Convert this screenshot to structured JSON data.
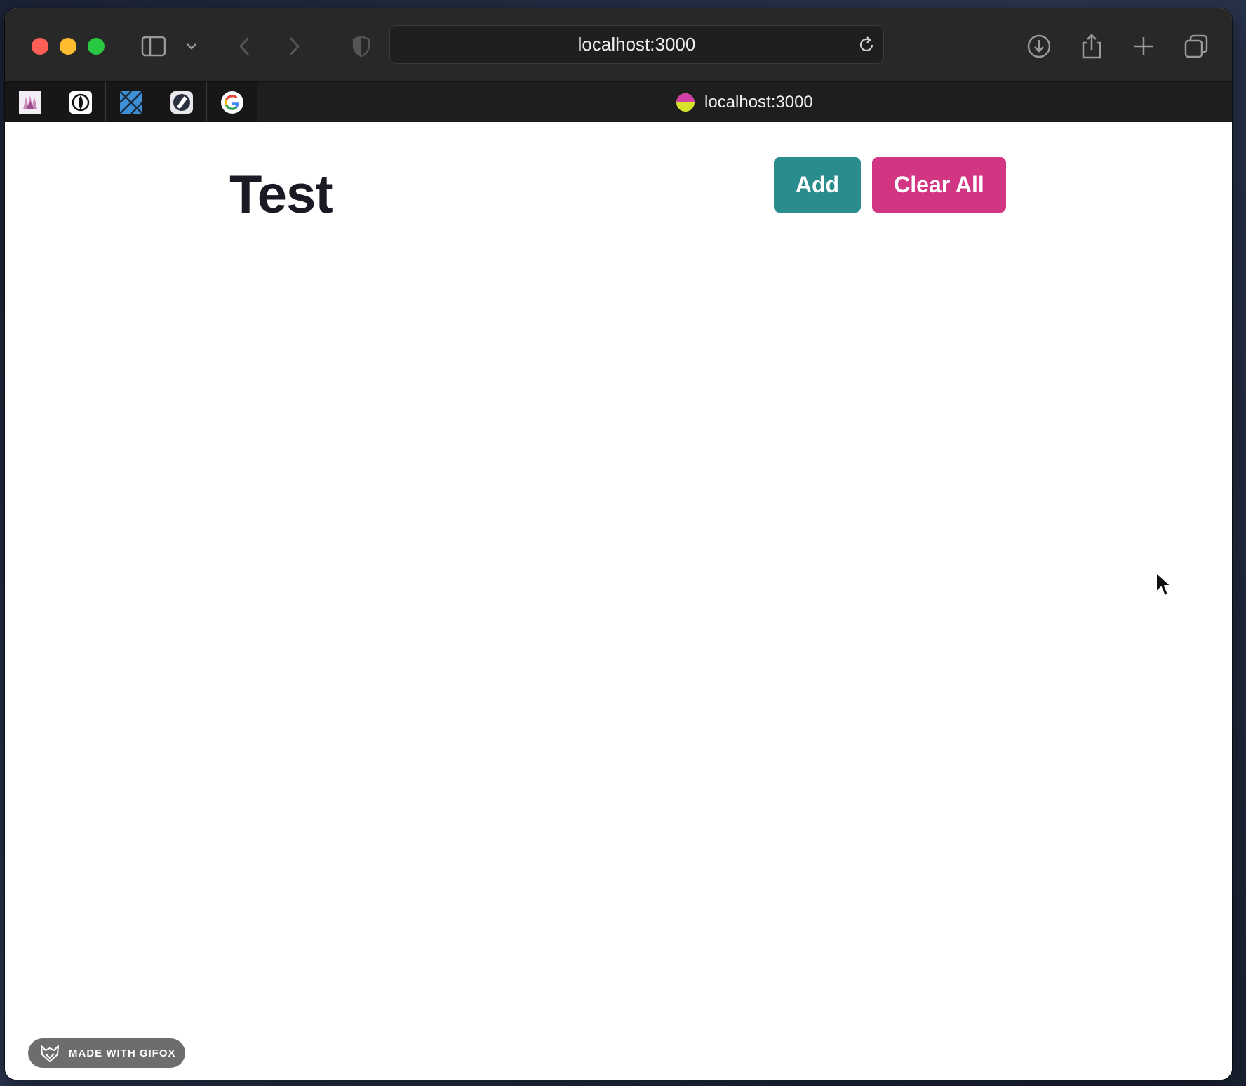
{
  "browser": {
    "address": "localhost:3000",
    "tab_title": "localhost:3000",
    "favorites": [
      "favorite-1",
      "favorite-2",
      "favorite-3",
      "favorite-4",
      "favorite-google"
    ]
  },
  "page": {
    "title": "Test",
    "add_label": "Add",
    "clear_label": "Clear All"
  },
  "watermark": {
    "text": "MADE WITH GIFOX"
  },
  "colors": {
    "add_button": "#2a8c8c",
    "clear_button": "#d23683",
    "title_text": "#1a1a25"
  }
}
